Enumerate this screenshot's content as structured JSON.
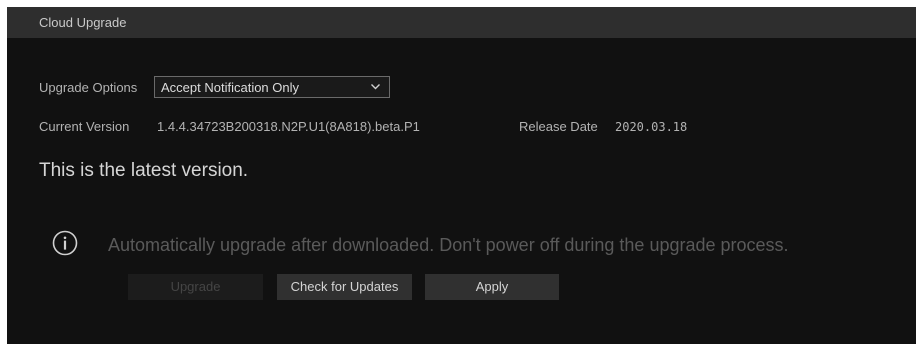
{
  "window": {
    "title": "Cloud Upgrade"
  },
  "upgrade_options": {
    "label": "Upgrade Options",
    "selected": "Accept Notification Only"
  },
  "version_info": {
    "current_version_label": "Current Version",
    "current_version_value": "1.4.4.34723B200318.N2P.U1(8A818).beta.P1",
    "release_date_label": "Release Date",
    "release_date_value": "2020.03.18"
  },
  "status": {
    "message": "This is the latest version."
  },
  "notice": {
    "icon": "info-icon",
    "text": "Automatically upgrade after downloaded. Don't power off during the upgrade process."
  },
  "buttons": {
    "upgrade": "Upgrade",
    "check_updates": "Check for Updates",
    "apply": "Apply"
  },
  "colors": {
    "background": "#111111",
    "title_bar": "#2e2e2e",
    "button": "#303030"
  }
}
